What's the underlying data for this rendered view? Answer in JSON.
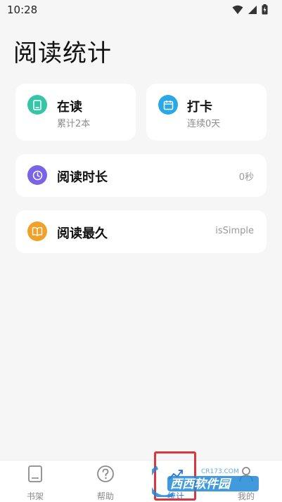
{
  "status_bar": {
    "time": "10:28",
    "icons": [
      "wifi-icon",
      "signal-icon",
      "battery-charging-icon"
    ]
  },
  "page": {
    "title": "阅读统计"
  },
  "cards": {
    "reading": {
      "title": "在读",
      "subtitle": "累计2本",
      "icon": "book-icon",
      "color": "#35c6a7"
    },
    "checkin": {
      "title": "打卡",
      "subtitle": "连续0天",
      "icon": "calendar-icon",
      "color": "#2aa7e6"
    },
    "duration": {
      "title": "阅读时长",
      "value": "0秒",
      "icon": "clock-icon",
      "color": "#7b63e8"
    },
    "longest": {
      "title": "阅读最久",
      "value": "isSimple",
      "icon": "open-book-icon",
      "color": "#f0a12a"
    }
  },
  "bottom_nav": {
    "items": [
      {
        "label": "书架",
        "icon": "book-icon"
      },
      {
        "label": "帮助",
        "icon": "help-icon"
      },
      {
        "label": "统计",
        "icon": "stats-icon"
      },
      {
        "label": "我的",
        "icon": "user-icon"
      }
    ],
    "active_index": 2,
    "accent": "#2f6fd6"
  },
  "watermark": {
    "text": "西西软件园",
    "sub": "CR173.COM"
  }
}
